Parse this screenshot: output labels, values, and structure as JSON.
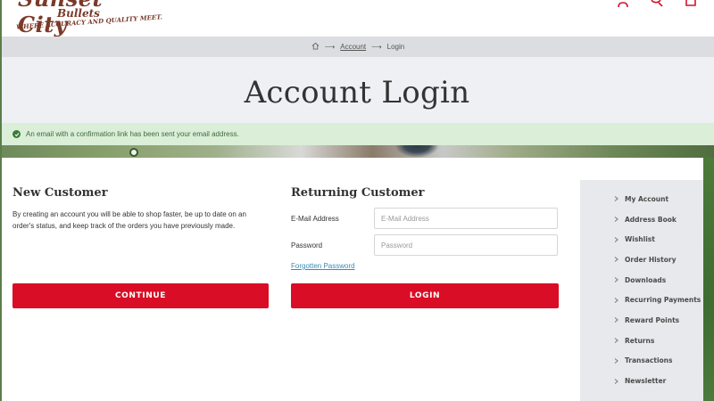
{
  "header": {
    "logo": {
      "script": "Sunset City",
      "bullets": "Bullets",
      "tagline": "WHERE ACCURACY AND QUALITY MEET."
    },
    "icons": [
      "user-icon",
      "search-icon",
      "cart-icon"
    ]
  },
  "breadcrumb": {
    "home_icon": "home-icon",
    "separator": "⟶",
    "items": [
      "Account",
      "Login"
    ]
  },
  "page_title": "Account Login",
  "alert": {
    "icon": "check-circle-icon",
    "message": "An email with a confirmation link has been sent your email address."
  },
  "new_customer": {
    "heading": "New Customer",
    "description": "By creating an account you will be able to shop faster, be up to date on an order's status, and keep track of the orders you have previously made.",
    "button": "CONTINUE"
  },
  "returning_customer": {
    "heading": "Returning Customer",
    "email_label": "E-Mail Address",
    "email_placeholder": "E-Mail Address",
    "email_value": "",
    "password_label": "Password",
    "password_placeholder": "Password",
    "password_value": "",
    "forgot_link": "Forgotten Password",
    "button": "LOGIN"
  },
  "sidebar": {
    "items": [
      {
        "label": "My Account"
      },
      {
        "label": "Address Book"
      },
      {
        "label": "Wishlist"
      },
      {
        "label": "Order History"
      },
      {
        "label": "Downloads"
      },
      {
        "label": "Recurring Payments"
      },
      {
        "label": "Reward Points"
      },
      {
        "label": "Returns"
      },
      {
        "label": "Transactions"
      },
      {
        "label": "Newsletter"
      }
    ]
  },
  "colors": {
    "accent": "#d90d25",
    "alert_bg": "#dbeed8",
    "alert_text": "#3c6b3a",
    "link": "#3a8ab8"
  }
}
